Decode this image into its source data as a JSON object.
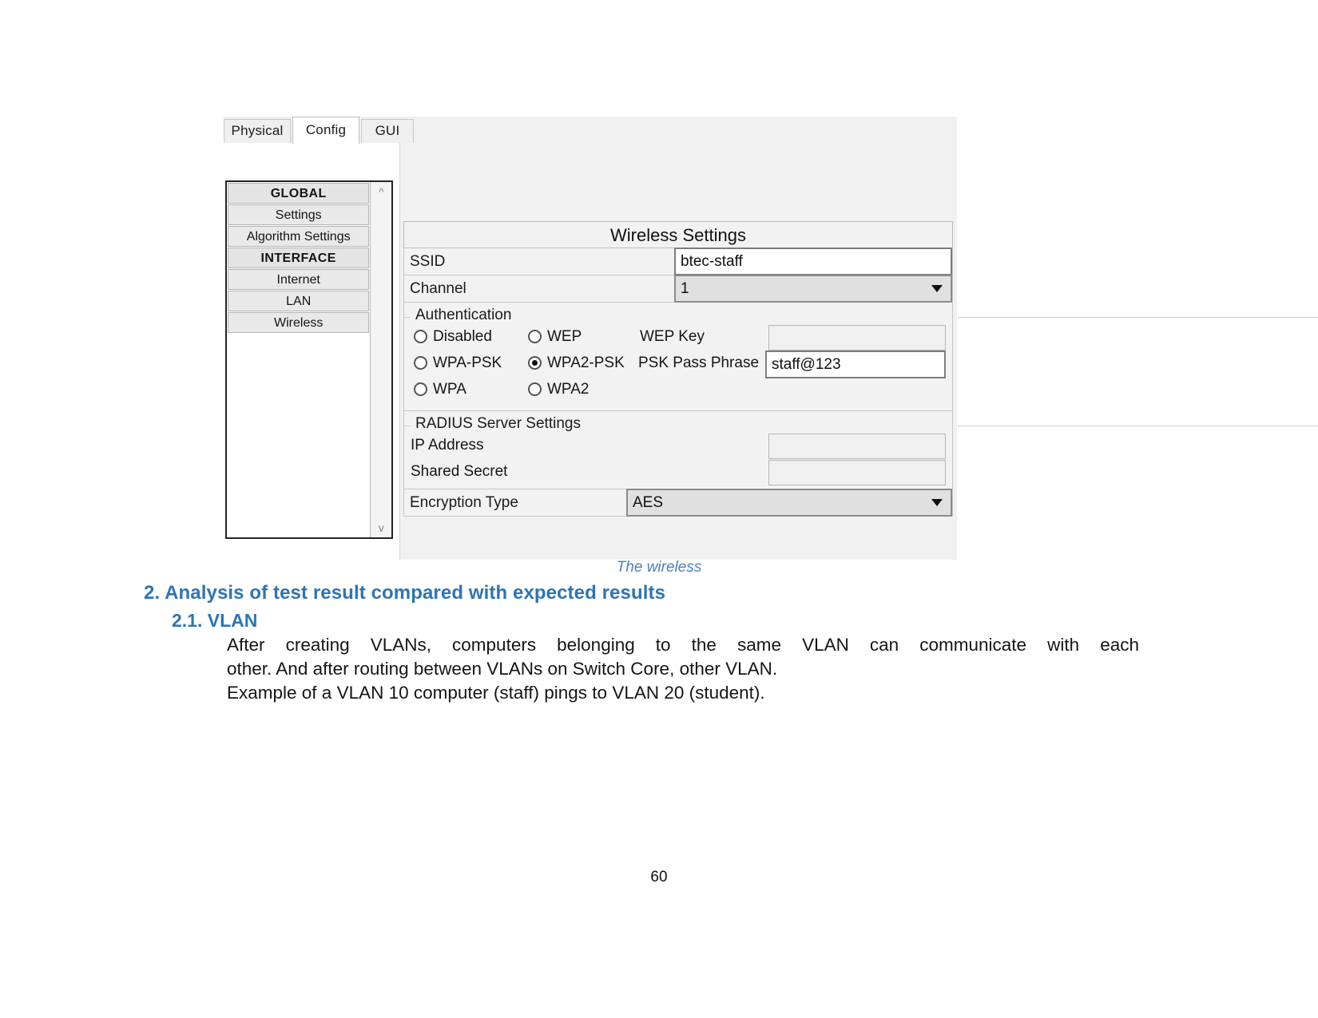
{
  "figure": {
    "tabs": [
      {
        "label": "Physical",
        "active": false
      },
      {
        "label": "Config",
        "active": true
      },
      {
        "label": "GUI",
        "active": false
      }
    ],
    "sidebar": {
      "items": [
        {
          "label": "GLOBAL",
          "type": "header"
        },
        {
          "label": "Settings",
          "type": "item"
        },
        {
          "label": "Algorithm Settings",
          "type": "item"
        },
        {
          "label": "INTERFACE",
          "type": "header"
        },
        {
          "label": "Internet",
          "type": "item"
        },
        {
          "label": "LAN",
          "type": "item"
        },
        {
          "label": "Wireless",
          "type": "item"
        }
      ],
      "scroll_up_icon": "chevron-up-icon",
      "scroll_down_icon": "chevron-down-icon"
    },
    "panel": {
      "title": "Wireless Settings",
      "ssid": {
        "label": "SSID",
        "value": "btec-staff"
      },
      "channel": {
        "label": "Channel",
        "value": "1",
        "caret_icon": "chevron-down-icon"
      },
      "authentication": {
        "legend": "Authentication",
        "options": [
          {
            "label": "Disabled",
            "checked": false
          },
          {
            "label": "WEP",
            "checked": false
          },
          {
            "label": "WPA-PSK",
            "checked": false
          },
          {
            "label": "WPA2-PSK",
            "checked": true
          },
          {
            "label": "WPA",
            "checked": false
          },
          {
            "label": "WPA2",
            "checked": false
          }
        ],
        "wep_key": {
          "label": "WEP Key",
          "value": ""
        },
        "psk_pass_phrase": {
          "label": "PSK Pass Phrase",
          "value": "staff@123"
        }
      },
      "radius": {
        "legend": "RADIUS Server Settings",
        "ip_address": {
          "label": "IP Address",
          "value": ""
        },
        "shared_secret": {
          "label": "Shared Secret",
          "value": ""
        }
      },
      "encryption": {
        "label": "Encryption Type",
        "value": "AES",
        "caret_icon": "chevron-down-icon"
      }
    }
  },
  "document": {
    "caption": "The wireless",
    "heading1": "2. Analysis of test result compared with expected results",
    "heading2": "2.1. VLAN",
    "paragraph_line1": "After creating VLANs, computers belonging to the same VLAN can communicate with each",
    "paragraph_line2": "other. And after routing between VLANs on Switch Core, other VLAN.",
    "paragraph_line3": "Example of a VLAN 10 computer (staff) pings to VLAN 20 (student).",
    "page_number": "60"
  },
  "colors": {
    "heading_blue": "#2e74b5",
    "caption_blue": "#4f81bd"
  }
}
